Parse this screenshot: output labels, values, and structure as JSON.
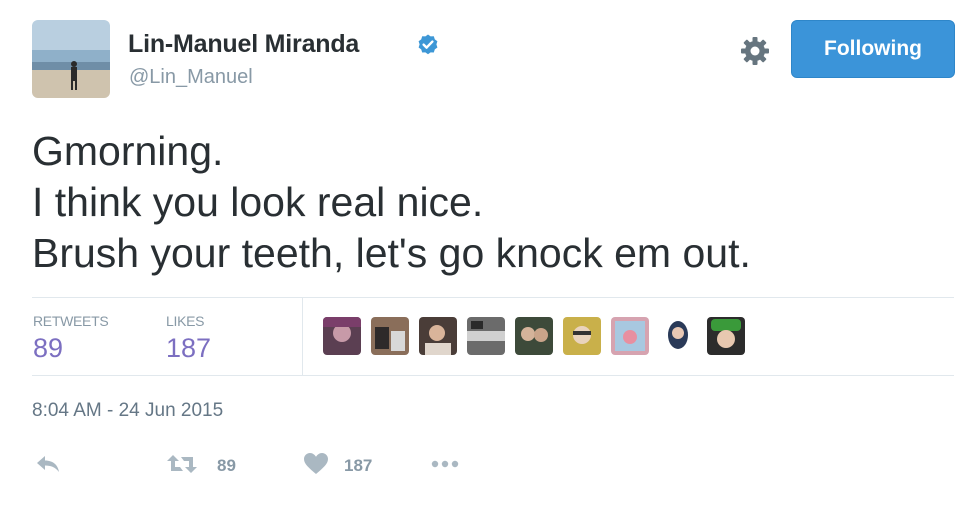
{
  "author": {
    "name": "Lin-Manuel Miranda",
    "handle": "@Lin_Manuel",
    "verified_icon": "verified-badge-icon",
    "avatar_icon": "beach-silhouette-avatar"
  },
  "header": {
    "settings_icon": "gear-icon",
    "follow_button_label": "Following"
  },
  "tweet": {
    "lines": [
      "Gmorning.",
      "I think you look real nice.",
      "Brush your teeth, let's go knock em out."
    ]
  },
  "stats": {
    "retweets_label": "RETWEETS",
    "retweets_value": "89",
    "likes_label": "LIKES",
    "likes_value": "187"
  },
  "likers": {
    "count_shown": 9,
    "avatar_colors": [
      "#5b3f52",
      "#8a6e5a",
      "#4a3d38",
      "#6b6b6b",
      "#3d4a3a",
      "#c9b04a",
      "#d6a3b0",
      "#3a4a68",
      "#3a8a3a"
    ]
  },
  "timestamp": "8:04 AM - 24 Jun 2015",
  "actions": {
    "reply_icon": "reply-icon",
    "retweet_icon": "retweet-icon",
    "retweet_count": "89",
    "like_icon": "heart-icon",
    "like_count": "187",
    "more_icon": "more-dots-icon"
  },
  "colors": {
    "accent": "#3b94d9",
    "stat_value": "#7c6fc1",
    "muted": "#8899a6"
  }
}
